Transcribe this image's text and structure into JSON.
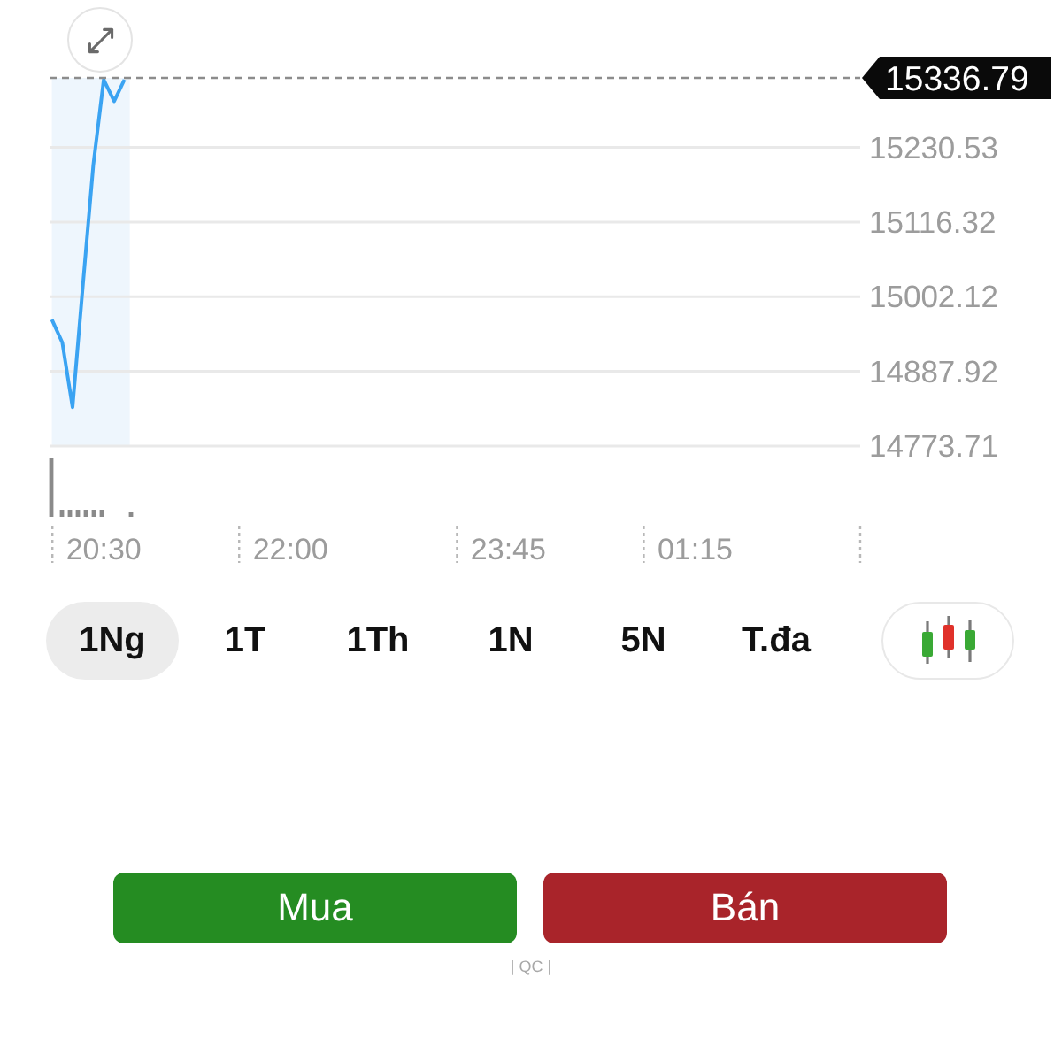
{
  "chart": {
    "current_price": "15336.79",
    "chart_data": {
      "type": "line",
      "grid": true,
      "categories": [
        null,
        null,
        null,
        null,
        null,
        "20:30",
        null,
        null,
        null,
        null,
        null,
        null,
        null,
        null,
        null,
        null,
        null,
        null,
        null,
        null,
        null,
        null,
        null,
        "22:00",
        null,
        null,
        null,
        null,
        null,
        null,
        null,
        null,
        null,
        null,
        null,
        null,
        null,
        null,
        null,
        null,
        null,
        null,
        null,
        null,
        "23:45",
        null,
        null,
        null,
        null,
        null,
        null,
        null,
        null,
        null,
        null,
        null,
        null,
        null,
        null,
        null,
        null,
        null,
        "01:15",
        null,
        null,
        null,
        null,
        null,
        null,
        null,
        null,
        null,
        null,
        null,
        null,
        null,
        null,
        null,
        null
      ],
      "values": [
        14967,
        14932,
        14833,
        15022,
        15203,
        15334,
        15301,
        15334,
        null,
        null,
        null,
        null,
        null,
        null,
        null,
        null,
        null,
        null,
        null,
        null,
        null,
        null,
        null,
        null,
        null,
        null,
        null,
        null,
        null,
        null,
        null,
        null,
        null,
        null,
        null,
        null,
        null,
        null,
        null,
        null,
        null,
        null,
        null,
        null,
        null,
        null,
        null,
        null,
        null,
        null,
        null,
        null,
        null,
        null,
        null,
        null,
        null,
        null,
        null,
        null,
        null,
        null,
        null,
        null,
        null,
        null,
        null,
        null,
        null,
        null,
        null,
        null,
        null,
        null,
        null,
        null,
        null,
        null,
        null
      ],
      "ylim": [
        14773.71,
        15336.79
      ],
      "yticks": [
        {
          "value": 15230.53,
          "label": "15230.53"
        },
        {
          "value": 15116.32,
          "label": "15116.32"
        },
        {
          "value": 15002.12,
          "label": "15002.12"
        },
        {
          "value": 14887.92,
          "label": "14887.92"
        },
        {
          "value": 14773.71,
          "label": "14773.71"
        }
      ]
    }
  },
  "periods": [
    {
      "label": "1Ng",
      "selected": true
    },
    {
      "label": "1T",
      "selected": false
    },
    {
      "label": "1Th",
      "selected": false
    },
    {
      "label": "1N",
      "selected": false
    },
    {
      "label": "5N",
      "selected": false
    },
    {
      "label": "T.đa",
      "selected": false
    }
  ],
  "actions": [
    {
      "label": "Mua",
      "kind": "buy"
    },
    {
      "label": "Bán",
      "kind": "sell"
    }
  ],
  "ad_label": "| QC |"
}
